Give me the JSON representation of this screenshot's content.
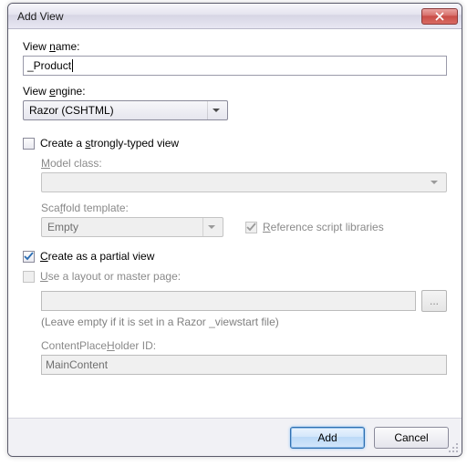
{
  "window": {
    "title": "Add View"
  },
  "labels": {
    "view_name": "View name:",
    "view_name_u": "n",
    "view_engine": "View engine:",
    "view_engine_u": "e",
    "strongly_typed": "Create a strongly-typed view",
    "strongly_typed_u": "s",
    "model_class": "Model class:",
    "model_class_u": "M",
    "scaffold": "Scaffold template:",
    "scaffold_u": "f",
    "ref_scripts": "Reference script libraries",
    "ref_scripts_u": "R",
    "partial": "Create as a partial view",
    "partial_u": "C",
    "use_layout": "Use a layout or master page:",
    "use_layout_u": "U",
    "hint": "(Leave empty if it is set in a Razor _viewstart file)",
    "cph": "ContentPlaceHolder ID:",
    "cph_u": "H"
  },
  "values": {
    "view_name": "_Product",
    "engine": "Razor (CSHTML)",
    "model_class": "",
    "scaffold": "Empty",
    "layout_path": "",
    "cph": "MainContent",
    "browse": "..."
  },
  "checks": {
    "strongly_typed": false,
    "ref_scripts": true,
    "partial": true,
    "use_layout": false
  },
  "buttons": {
    "add": "Add",
    "cancel": "Cancel"
  }
}
